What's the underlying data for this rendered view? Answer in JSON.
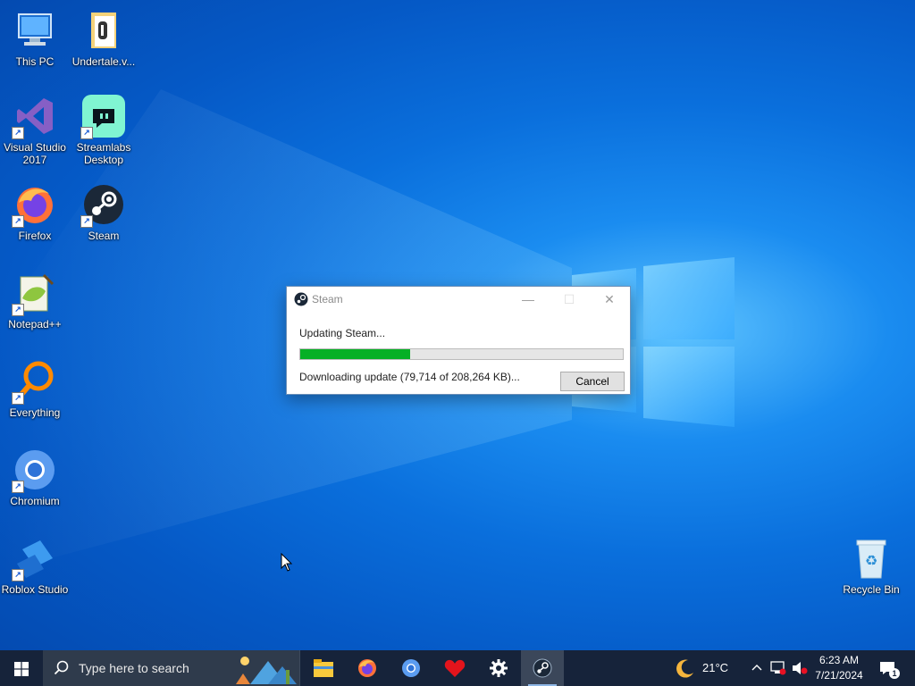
{
  "desktop": {
    "icons": [
      {
        "label": "This PC",
        "icon": "this-pc-icon"
      },
      {
        "label": "Undertale.v...",
        "icon": "folder-icon"
      },
      {
        "label": "Visual Studio 2017",
        "icon": "visual-studio-icon"
      },
      {
        "label": "Streamlabs Desktop",
        "icon": "streamlabs-icon"
      },
      {
        "label": "Firefox",
        "icon": "firefox-icon"
      },
      {
        "label": "Steam",
        "icon": "steam-icon"
      },
      {
        "label": "Notepad++",
        "icon": "notepad-plus-plus-icon"
      },
      {
        "label": "Everything",
        "icon": "everything-search-icon"
      },
      {
        "label": "Chromium",
        "icon": "chromium-icon"
      },
      {
        "label": "Roblox Studio",
        "icon": "roblox-studio-icon"
      },
      {
        "label": "Recycle Bin",
        "icon": "recycle-bin-icon"
      }
    ]
  },
  "dialog": {
    "title": "Steam",
    "message": "Updating Steam...",
    "progress_percent": 34,
    "status": "Downloading update (79,714 of 208,264 KB)...",
    "cancel_label": "Cancel",
    "minimize_glyph": "—",
    "maximize_glyph": "☐",
    "close_glyph": "✕"
  },
  "taskbar": {
    "search_placeholder": "Type here to search",
    "pinned": [
      "file-explorer-icon",
      "firefox-icon",
      "chromium-icon",
      "heart-app-icon",
      "settings-gear-icon",
      "steam-icon"
    ],
    "weather": {
      "temp": "21°C",
      "icon": "moon-icon"
    },
    "clock": {
      "time": "6:23 AM",
      "date": "7/21/2024"
    },
    "notification_count": "1"
  },
  "colors": {
    "progress_fill": "#06b025",
    "taskbar_bg": "#16233a",
    "desktop_accent": "#0a6fdc"
  }
}
